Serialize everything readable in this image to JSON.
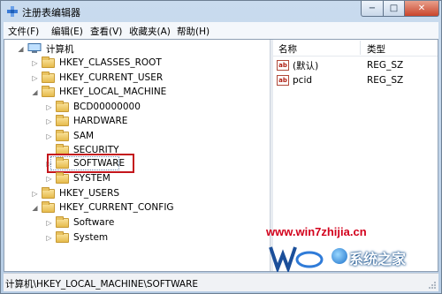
{
  "window": {
    "title": "注册表编辑器",
    "controls": {
      "minimize": "−",
      "maximize": "□",
      "close": "✕"
    }
  },
  "menu": [
    "文件(F)",
    "编辑(E)",
    "查看(V)",
    "收藏夹(A)",
    "帮助(H)"
  ],
  "tree": {
    "root": "计算机",
    "nodes": [
      {
        "label": "HKEY_CLASSES_ROOT",
        "expander": "▷",
        "icon": "folder-icon"
      },
      {
        "label": "HKEY_CURRENT_USER",
        "expander": "▷",
        "icon": "folder-icon"
      },
      {
        "label": "HKEY_LOCAL_MACHINE",
        "expander": "◢",
        "icon": "folder-icon"
      },
      {
        "label": "BCD00000000",
        "expander": "▷",
        "icon": "folder-icon"
      },
      {
        "label": "HARDWARE",
        "expander": "▷",
        "icon": "folder-icon"
      },
      {
        "label": "SAM",
        "expander": "▷",
        "icon": "folder-icon"
      },
      {
        "label": "SECURITY",
        "expander": "",
        "icon": "folder-icon"
      },
      {
        "label": "SOFTWARE",
        "expander": "▷",
        "icon": "folder-icon",
        "selected": true
      },
      {
        "label": "SYSTEM",
        "expander": "▷",
        "icon": "folder-icon"
      },
      {
        "label": "HKEY_USERS",
        "expander": "▷",
        "icon": "folder-icon"
      },
      {
        "label": "HKEY_CURRENT_CONFIG",
        "expander": "◢",
        "icon": "folder-icon"
      },
      {
        "label": "Software",
        "expander": "▷",
        "icon": "folder-icon"
      },
      {
        "label": "System",
        "expander": "▷",
        "icon": "folder-icon"
      }
    ]
  },
  "list": {
    "columns": {
      "name": "名称",
      "type": "类型"
    },
    "rows": [
      {
        "name": "(默认)",
        "type": "REG_SZ",
        "icon": "ab"
      },
      {
        "name": "pcid",
        "type": "REG_SZ",
        "icon": "ab"
      }
    ]
  },
  "watermark": {
    "url": "www.win7zhijia.cn",
    "brand": "系统之家"
  },
  "status": "计算机\\HKEY_LOCAL_MACHINE\\SOFTWARE",
  "colors": {
    "highlight_box": "#c4161c",
    "watermark_url": "#d3001c"
  }
}
